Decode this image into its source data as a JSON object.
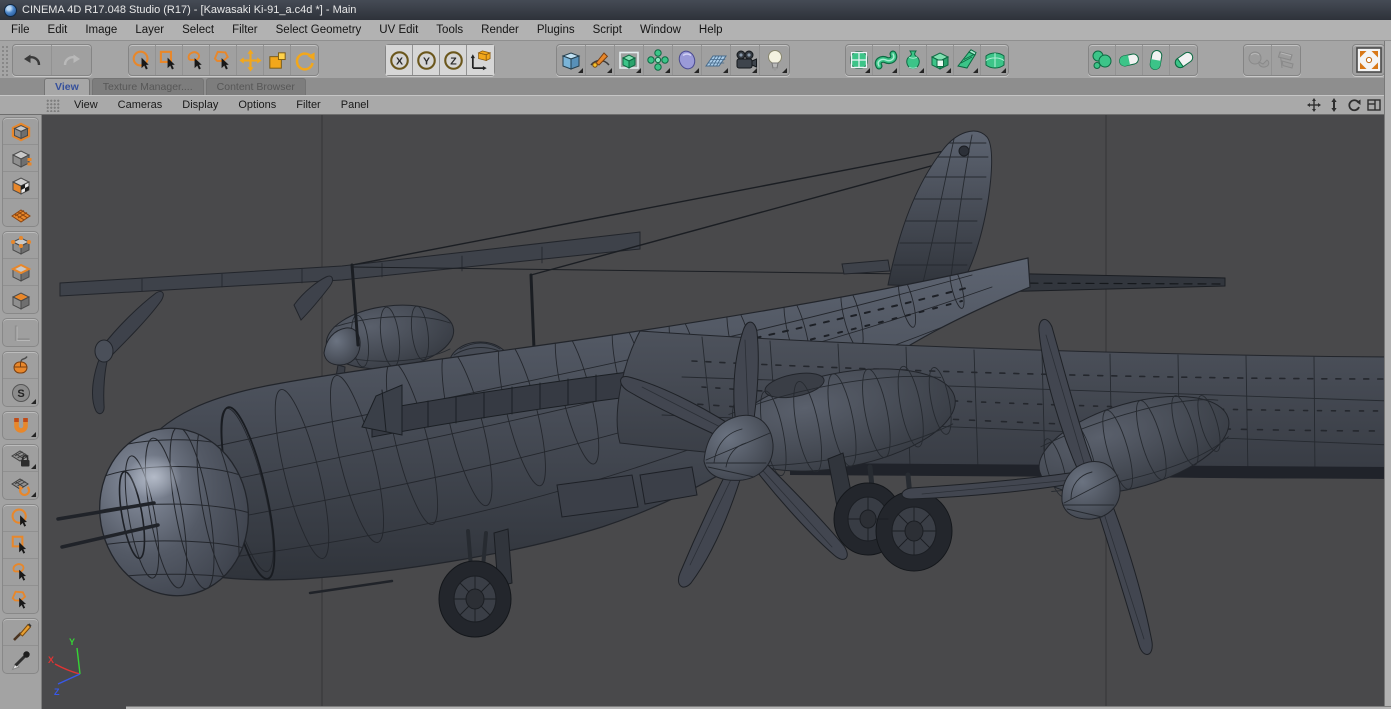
{
  "window": {
    "title": "CINEMA 4D R17.048 Studio (R17) - [Kawasaki Ki-91_a.c4d *] - Main",
    "app_icon": "cinema4d-logo"
  },
  "menubar": {
    "items": [
      "File",
      "Edit",
      "Image",
      "Layer",
      "Select",
      "Filter",
      "Select Geometry",
      "UV Edit",
      "Tools",
      "Render",
      "Plugins",
      "Script",
      "Window",
      "Help"
    ]
  },
  "toolbar": {
    "groups": [
      {
        "name": "history",
        "buttons": [
          {
            "icon": "undo-icon",
            "enabled": true
          },
          {
            "icon": "redo-icon",
            "enabled": false
          }
        ]
      },
      {
        "name": "selection-tools",
        "buttons": [
          {
            "icon": "live-selection-icon"
          },
          {
            "icon": "rectangle-selection-icon"
          },
          {
            "icon": "lasso-selection-icon"
          },
          {
            "icon": "polygon-selection-icon"
          },
          {
            "icon": "move-tool-icon"
          },
          {
            "icon": "scale-tool-icon"
          },
          {
            "icon": "rotate-tool-icon"
          }
        ]
      },
      {
        "name": "axis-lock",
        "buttons": [
          {
            "icon": "x-axis-lock-icon",
            "label": "X"
          },
          {
            "icon": "y-axis-lock-icon",
            "label": "Y"
          },
          {
            "icon": "z-axis-lock-icon",
            "label": "Z"
          },
          {
            "icon": "coordinate-system-icon"
          }
        ]
      },
      {
        "name": "create-objects",
        "buttons": [
          {
            "icon": "add-cube-icon"
          },
          {
            "icon": "spline-pen-icon"
          },
          {
            "icon": "generators-icon"
          },
          {
            "icon": "array-icon"
          },
          {
            "icon": "metaball-icon"
          },
          {
            "icon": "environment-floor-icon"
          },
          {
            "icon": "camera-icon"
          },
          {
            "icon": "light-icon"
          }
        ]
      },
      {
        "name": "modeling-generators",
        "buttons": [
          {
            "icon": "subdivision-surface-icon"
          },
          {
            "icon": "sweep-icon"
          },
          {
            "icon": "lathe-icon"
          },
          {
            "icon": "extrude-icon"
          },
          {
            "icon": "loft-icon"
          },
          {
            "icon": "bezier-icon"
          }
        ]
      },
      {
        "name": "deformers",
        "buttons": [
          {
            "icon": "metaball-blob-icon"
          },
          {
            "icon": "boole-union-icon"
          },
          {
            "icon": "boole-intersect-icon"
          },
          {
            "icon": "boole-subtract-icon"
          }
        ]
      },
      {
        "name": "disabled-tools",
        "buttons": [
          {
            "icon": "disabled-tool-1-icon",
            "enabled": false
          },
          {
            "icon": "disabled-tool-2-icon",
            "enabled": false
          }
        ]
      },
      {
        "name": "layout",
        "buttons": [
          {
            "icon": "maximize-view-icon",
            "active": true
          }
        ]
      }
    ]
  },
  "panel_tabs": {
    "tabs": [
      {
        "label": "View",
        "active": true
      },
      {
        "label": "Texture Manager....",
        "active": false
      },
      {
        "label": "Content Browser",
        "active": false
      }
    ]
  },
  "viewport_menu": {
    "items": [
      "View",
      "Cameras",
      "Display",
      "Options",
      "Filter",
      "Panel"
    ],
    "nav_icons": [
      "pan-view-icon",
      "zoom-view-icon",
      "rotate-view-icon",
      "toggle-panel-icon"
    ]
  },
  "sidebar": {
    "items": [
      {
        "icon": "make-editable-icon"
      },
      {
        "icon": "model-mode-icon"
      },
      {
        "icon": "texture-mode-icon"
      },
      {
        "icon": "workplane-mode-icon"
      },
      {
        "icon": "points-mode-icon"
      },
      {
        "icon": "edges-mode-icon"
      },
      {
        "icon": "polygons-mode-icon"
      },
      {
        "icon": "axis-mode-icon",
        "enabled": false
      },
      {
        "icon": "viewport-solo-icon"
      },
      {
        "icon": "snap-settings-icon",
        "label": "S"
      },
      {
        "icon": "enable-snap-icon"
      },
      {
        "icon": "lock-workplane-icon"
      },
      {
        "icon": "planar-workplane-icon"
      },
      {
        "icon": "live-selection-icon"
      },
      {
        "icon": "rectangle-selection-icon"
      },
      {
        "icon": "lasso-selection-icon"
      },
      {
        "icon": "polygon-selection-icon"
      },
      {
        "icon": "brush-icon"
      },
      {
        "icon": "eyedropper-icon"
      }
    ]
  },
  "viewport": {
    "model": "Wireframe 3D model of a Kawasaki Ki-91 four-engine bomber, gouraud shading with lines",
    "axis": {
      "x": "X",
      "y": "Y",
      "z": "Z"
    },
    "colors": {
      "background": "#49494b",
      "grid_line": "#3c3c3e",
      "wireframe": "#22252b",
      "body": "#474c56",
      "axis_x": "#e03434",
      "axis_y": "#35d435",
      "axis_z": "#3858e8",
      "accent_orange": "#e8872a",
      "accent_green": "#3cc488",
      "accent_yellow": "#f2a71b"
    }
  }
}
